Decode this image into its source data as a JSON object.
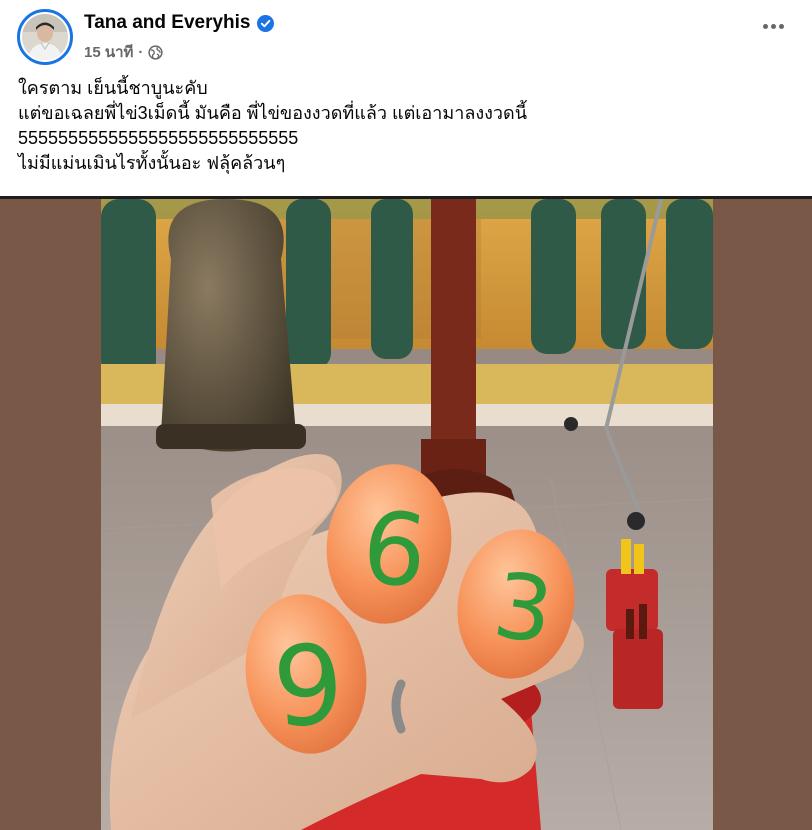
{
  "post": {
    "author": "Tana and Everyhis",
    "timestamp": "15 นาที",
    "separator": "·",
    "audience_icon": "globe-icon",
    "verified_icon": "verified-badge-icon",
    "more_icon": "more-options-icon",
    "text_lines": [
      "ใครตาม เย็นนี้ชาบูนะคับ",
      "แต่ขอเฉลยพี่ไข่3เม็ดนี้  มันคือ พี่ไข่ของงวดที่แล้ว  แต่เอามาลงงวดนี้",
      "5555555555555555555555555555",
      "ไม่มีแม่นเมินไรทั้งนั้นอะ ฟลุ้คล้วนๆ"
    ]
  },
  "photo": {
    "egg_numbers": [
      "9",
      "6",
      "3"
    ]
  },
  "colors": {
    "background": "#ffffff",
    "text": "#050505",
    "secondary_text": "#65676b",
    "verified_blue": "#1b74e4",
    "media_backdrop": "#7a5848",
    "egg": "#f5955e",
    "egg_number": "#2f9a3a"
  }
}
